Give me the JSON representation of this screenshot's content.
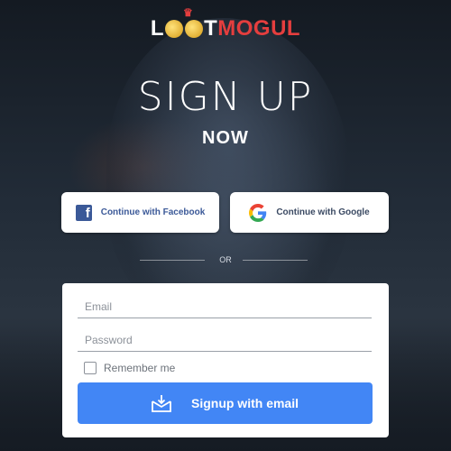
{
  "brand": {
    "name_part1": "L",
    "name_part2": "T",
    "name_part3": "MOGUL",
    "accent_color": "#e53e3e",
    "icons": [
      "crown-icon",
      "coin-icon"
    ]
  },
  "header": {
    "title": "SIGN UP",
    "subtitle": "NOW"
  },
  "social": {
    "facebook_label": "Continue with Facebook",
    "google_label": "Continue with Google",
    "facebook_icon": "facebook-icon",
    "google_icon": "google-icon"
  },
  "divider": {
    "text": "OR"
  },
  "form": {
    "email_placeholder": "Email",
    "email_value": "",
    "password_placeholder": "Password",
    "password_value": "",
    "remember_label": "Remember me",
    "remember_checked": false,
    "signup_label": "Signup with email",
    "signup_icon": "mail-download-icon",
    "signup_color": "#4286f5"
  }
}
